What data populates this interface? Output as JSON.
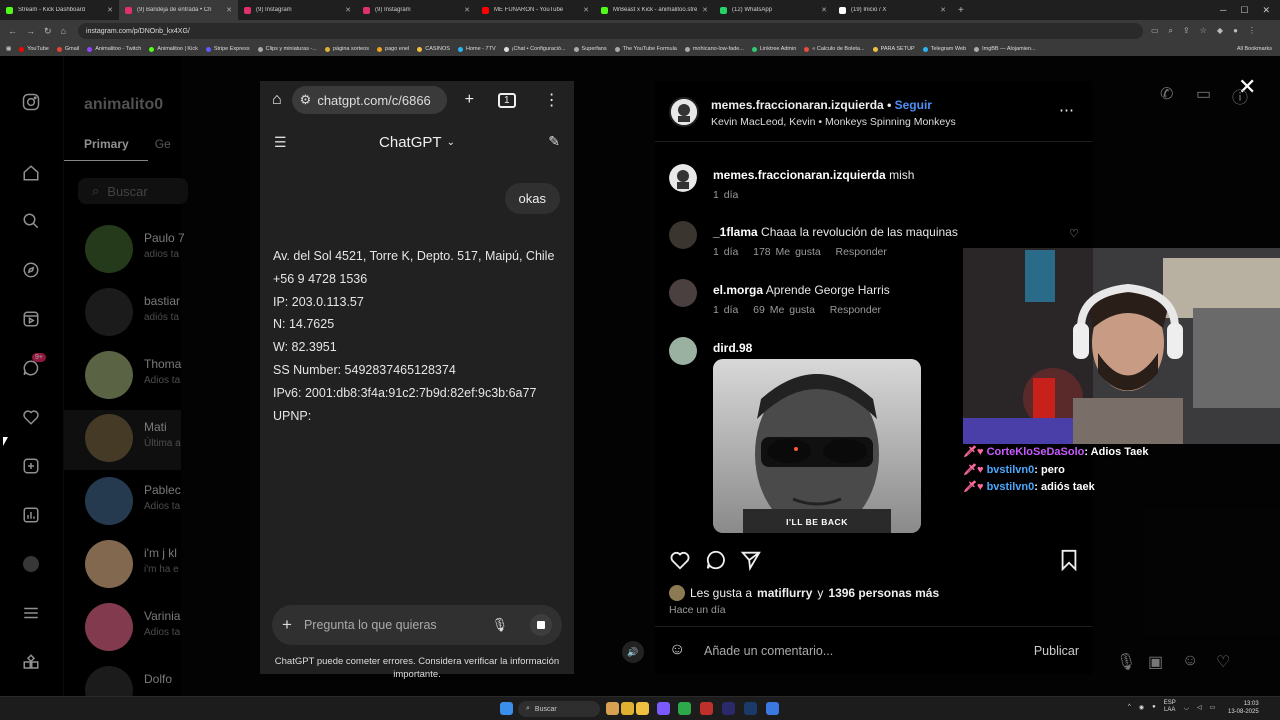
{
  "browser": {
    "tabs": [
      {
        "title": "Stream - Kick Dashboard",
        "color": "#53fc18",
        "active": false
      },
      {
        "title": "(9) Bandeja de entrada • Ch",
        "color": "#e1306c",
        "active": true
      },
      {
        "title": "(9) Instagram",
        "color": "#e1306c",
        "active": false
      },
      {
        "title": "(9) Instagram",
        "color": "#e1306c",
        "active": false
      },
      {
        "title": "ME FUNARON - YouTube",
        "color": "#ff0000",
        "active": false
      },
      {
        "title": "MrBeast x Kick - animalitoo.stre",
        "color": "#53fc18",
        "active": false
      },
      {
        "title": "(12) WhatsApp",
        "color": "#25d366",
        "active": false
      },
      {
        "title": "(19) Inicio / X",
        "color": "#ffffff",
        "active": false
      }
    ],
    "url": "instagram.com/p/DNOnb_kx4XG/",
    "bookmarks": [
      "YouTube",
      "Gmail",
      "Animalitoo - Twitch",
      "Animalitoo | Kick",
      "Stripe Express",
      "Clips y miniaturas -...",
      "página sorteos",
      "pago enel",
      "CASINOS",
      "Home - 7TV",
      "¡Chat • Configuració...",
      "Superfans",
      "The YouTube Formula",
      "mohicano-low-fade...",
      "Linktree Admin",
      "« Calculo de Boleta...",
      "PARA SETUP",
      "Telegram Web",
      "ImgBB — Alojamien..."
    ],
    "all_bookmarks": "All Bookmarks"
  },
  "instagram": {
    "username": "animalito0",
    "tab_primary": "Primary",
    "tab_general": "Ge",
    "search_placeholder": "Buscar",
    "notif_badge": "9+",
    "conversations": [
      {
        "name": "Paulo 7",
        "sub": "adios ta"
      },
      {
        "name": "bastiar",
        "sub": "adiós ta"
      },
      {
        "name": "Thoma",
        "sub": "Adios ta"
      },
      {
        "name": "Mati",
        "sub": "Última a"
      },
      {
        "name": "Pablec",
        "sub": "Adios ta"
      },
      {
        "name": "i'm j kl",
        "sub": "i'm ha e"
      },
      {
        "name": "Varinia",
        "sub": "Adios ta"
      },
      {
        "name": "Dolfo",
        "sub": ""
      }
    ]
  },
  "chatgpt": {
    "url": "chatgpt.com/c/6866",
    "tab_count": "1",
    "title": "ChatGPT",
    "user_bubble": "okas",
    "lines": [
      "Av. del Sol 4521, Torre K, Depto. 517, Maipú, Chile",
      "+56 9 4728 1536",
      "IP: 203.0.113.57",
      "N: 14.7625",
      "W: 82.3951",
      "SS Number: 5492837465128374",
      "IPv6: 2001:db8:3f4a:91c2:7b9d:82ef:9c3b:6a77",
      "UPNP:"
    ],
    "input_placeholder": "Pregunta lo que quieras",
    "footer": "ChatGPT puede cometer errores. Considera verificar la información importante."
  },
  "post": {
    "author": "memes.fraccionaran.izquierda",
    "follow": "Seguir",
    "audio": "Kevin MacLeod, Kevin • Monkeys Spinning Monkeys",
    "comments": [
      {
        "user": "memes.fraccionaran.izquierda",
        "text": "mish",
        "time": "1 día",
        "likes": "",
        "reply": ""
      },
      {
        "user": "_1flama",
        "text": "Chaaa la revolución de las maquinas",
        "time": "1 día",
        "likes": "178 Me gusta",
        "reply": "Responder"
      },
      {
        "user": "el.morga",
        "text": "Aprende George Harris",
        "time": "1 día",
        "likes": "69 Me gusta",
        "reply": "Responder"
      },
      {
        "user": "dird.98",
        "text": "",
        "time": "",
        "likes": "",
        "reply": ""
      }
    ],
    "gif_caption": "I'LL BE BACK",
    "likes_prefix": "Les gusta a",
    "likes_user": "matiflurry",
    "likes_join": "y",
    "likes_count": "1396 personas más",
    "time_ago": "Hace un día",
    "comment_placeholder": "Añade un comentario...",
    "publish": "Publicar"
  },
  "stream_chat": [
    {
      "user": "CorteKloSeDaSolo",
      "msg": "Adios Taek"
    },
    {
      "user": "bvstilvn0",
      "msg": "pero"
    },
    {
      "user": "bvstilvn0",
      "msg": "adiós taek"
    }
  ],
  "taskbar": {
    "search": "Buscar",
    "lang": "ESP",
    "region": "LAA",
    "time": "13:03",
    "date": "13-08-2025"
  }
}
